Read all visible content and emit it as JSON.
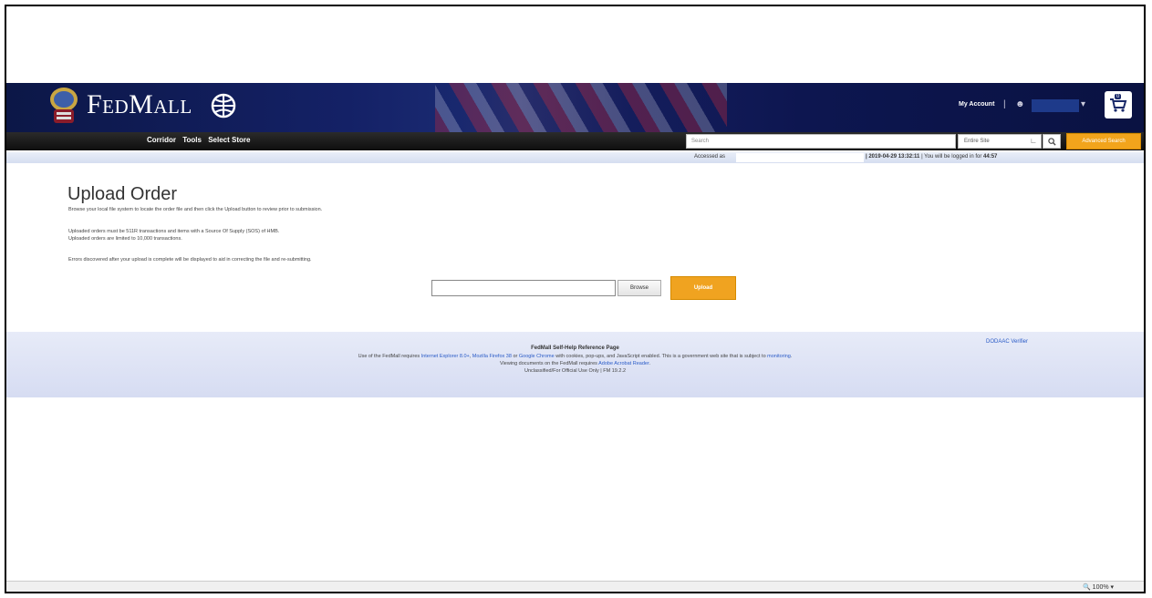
{
  "header": {
    "logo_text": "FedMall",
    "my_account": "My Account",
    "separator": "|",
    "cart_count": "0"
  },
  "nav": {
    "links": [
      "Corridor",
      "Tools",
      "Select Store"
    ],
    "search_placeholder": "Search",
    "scope_value": "Entire Site",
    "advanced_search": "Advanced Search"
  },
  "status": {
    "accessed_as": "Accessed as",
    "timestamp": "| 2019-04-29 13:32:11",
    "logged_in_text": "| You will be logged in for",
    "time_left": "44:57"
  },
  "main": {
    "title": "Upload Order",
    "line1": "Browse your local file system to locate the order file and then click the Upload button to review prior to submission.",
    "line2": "Uploaded orders must be 511R transactions and items with a Source Of Supply (SOS) of HMB.",
    "line3": "Uploaded orders are limited to 10,000 transactions.",
    "line4": "Errors discovered after your upload is complete will be displayed to aid in correcting the file and re-submitting.",
    "browse_label": "Browse",
    "upload_label": "Upload"
  },
  "footer": {
    "title": "FedMall Self-Help Reference Page",
    "req_prefix": "Use of the FedMall requires",
    "browser_ie": "Internet Explorer 8.0+",
    "browser_ff": "Mozilla Firefox 38",
    "or": "or",
    "browser_chrome": "Google Chrome",
    "req_suffix": "with cookies, pop-ups, and JavaScript enabled. This is a government web site that is subject to",
    "monitoring": "monitoring",
    "viewing": "Viewing documents on the FedMall requires",
    "acrobat": "Adobe Acrobat Reader",
    "classification": "Unclassified/For Official Use Only | FM 19.2.2",
    "dodaac": "DODAAC Verifier"
  },
  "browser": {
    "zoom": "100%"
  }
}
